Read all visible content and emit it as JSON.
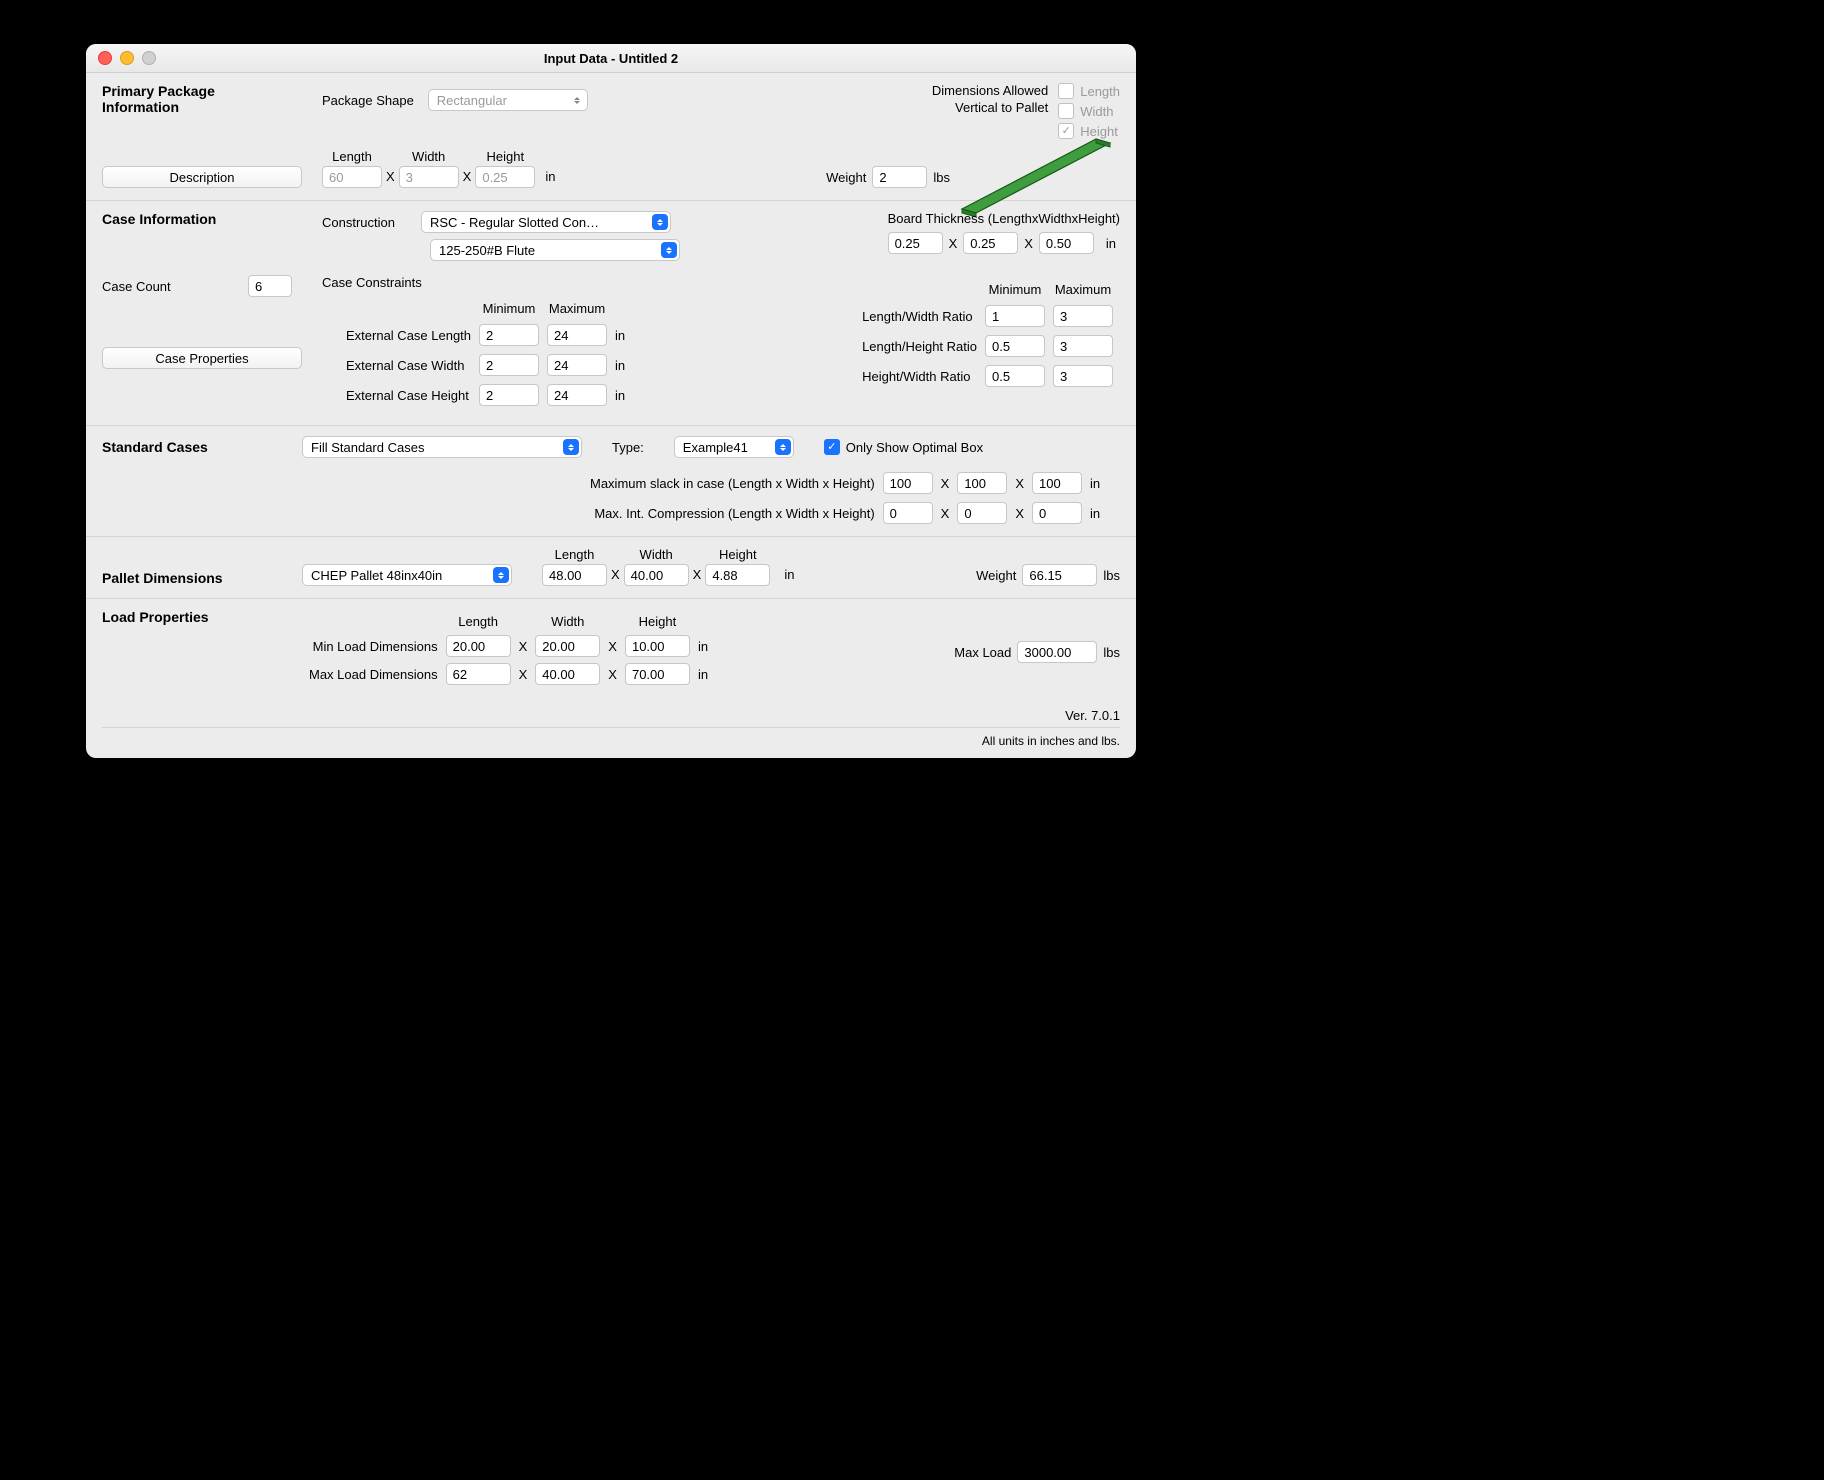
{
  "window": {
    "title": "Input Data - Untitled 2"
  },
  "primary": {
    "section_title": "Primary Package Information",
    "shape_label": "Package Shape",
    "shape_value": "Rectangular",
    "length_label": "Length",
    "width_label": "Width",
    "height_label": "Height",
    "length": "60",
    "width": "3",
    "height": "0.25",
    "unit": "in",
    "description_btn": "Description",
    "weight_label": "Weight",
    "weight": "2",
    "weight_unit": "lbs",
    "dims_allowed_label1": "Dimensions Allowed",
    "dims_allowed_label2": "Vertical to Pallet",
    "allow_length": "Length",
    "allow_width": "Width",
    "allow_height": "Height"
  },
  "case": {
    "section_title": "Case Information",
    "construction_label": "Construction",
    "construction_value": "RSC - Regular Slotted Con…",
    "flute_value": "125-250#B Flute",
    "board_thickness_label": "Board Thickness (LengthxWidthxHeight)",
    "bt_l": "0.25",
    "bt_w": "0.25",
    "bt_h": "0.50",
    "bt_unit": "in",
    "count_label": "Case Count",
    "count": "6",
    "constraints_label": "Case Constraints",
    "min_label": "Minimum",
    "max_label": "Maximum",
    "ext_len_label": "External Case Length",
    "ext_len_min": "2",
    "ext_len_max": "24",
    "ext_wid_label": "External Case Width",
    "ext_wid_min": "2",
    "ext_wid_max": "24",
    "ext_hgt_label": "External Case Height",
    "ext_hgt_min": "2",
    "ext_hgt_max": "24",
    "unit": "in",
    "lw_label": "Length/Width Ratio",
    "lw_min": "1",
    "lw_max": "3",
    "lh_label": "Length/Height Ratio",
    "lh_min": "0.5",
    "lh_max": "3",
    "hw_label": "Height/Width Ratio",
    "hw_min": "0.5",
    "hw_max": "3",
    "case_props_btn": "Case Properties"
  },
  "standard": {
    "section_title": "Standard Cases",
    "fill_value": "Fill Standard Cases",
    "type_label": "Type:",
    "type_value": "Example41",
    "only_optimal_label": "Only Show Optimal Box",
    "slack_label": "Maximum slack in case  (Length x Width x Height)",
    "slack_l": "100",
    "slack_w": "100",
    "slack_h": "100",
    "slack_unit": "in",
    "comp_label": "Max. Int. Compression (Length x Width x Height)",
    "comp_l": "0",
    "comp_w": "0",
    "comp_h": "0",
    "comp_unit": "in"
  },
  "pallet": {
    "section_title": "Pallet Dimensions",
    "pallet_value": "CHEP Pallet 48inx40in",
    "length_label": "Length",
    "width_label": "Width",
    "height_label": "Height",
    "length": "48.00",
    "width": "40.00",
    "height": "4.88",
    "unit": "in",
    "weight_label": "Weight",
    "weight": "66.15",
    "weight_unit": "lbs"
  },
  "load": {
    "section_title": "Load Properties",
    "length_label": "Length",
    "width_label": "Width",
    "height_label": "Height",
    "min_label": "Min Load Dimensions",
    "min_l": "20.00",
    "min_w": "20.00",
    "min_h": "10.00",
    "max_label": "Max Load Dimensions",
    "max_l": "62",
    "max_w": "40.00",
    "max_h": "70.00",
    "unit": "in",
    "maxload_label": "Max Load",
    "maxload": "3000.00",
    "maxload_unit": "lbs"
  },
  "footer": {
    "version": "Ver. 7.0.1",
    "units": "All units in inches and lbs."
  }
}
